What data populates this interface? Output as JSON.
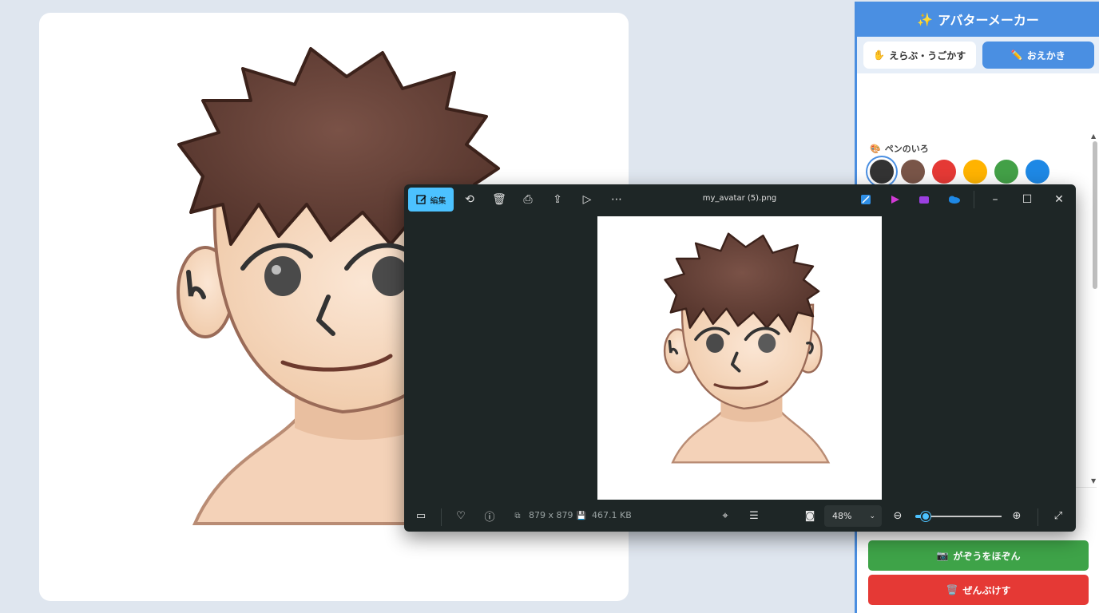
{
  "panel": {
    "title": "アバターメーカー",
    "title_icon": "✨",
    "tabs": [
      {
        "icon": "✋",
        "label": "えらぶ・うごかす",
        "active": false
      },
      {
        "icon": "✏️",
        "label": "おえかき",
        "active": true
      }
    ],
    "pen_color_label": "ペンのいろ",
    "pen_color_icon": "🎨",
    "pen_colors": [
      "#333333",
      "#795548",
      "#e53935",
      "#ffb300",
      "#43a047",
      "#1e88e5"
    ],
    "selected_pen_color": "#333333",
    "save_button": {
      "icon": "📷",
      "label": "がぞうをほぞん"
    },
    "clear_button": {
      "icon": "🗑️",
      "label": "ぜんぶけす"
    }
  },
  "viewer": {
    "edit_label": "編集",
    "file_name": "my_avatar (5).png",
    "dimensions": "879 x 879",
    "file_size": "467.1 KB",
    "zoom": "48%",
    "zoom_level": 0.12
  },
  "icons": {
    "edit": "edit-image-icon",
    "rotate": "rotate-icon",
    "delete": "trash-icon",
    "print": "print-icon",
    "share": "share-icon",
    "slideshow": "slideshow-icon",
    "more": "more-icon",
    "minimize": "minimize-icon",
    "maximize": "maximize-icon",
    "close": "close-icon"
  }
}
